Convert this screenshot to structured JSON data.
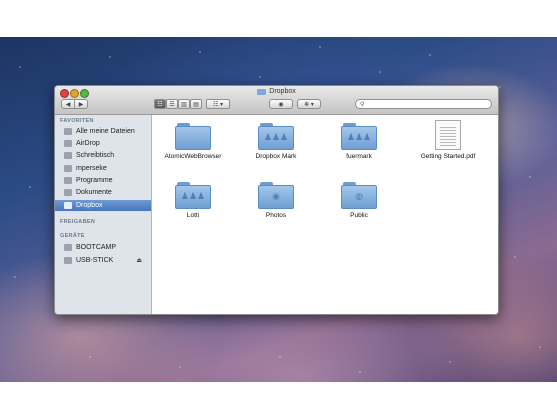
{
  "window": {
    "title": "Dropbox"
  },
  "toolbar": {
    "back_glyph": "◀",
    "forward_glyph": "▶",
    "view_icons": "☷",
    "view_list": "☰",
    "view_columns": "▥",
    "view_cover": "▤",
    "arrange": "☷ ▾",
    "quicklook": "◉",
    "action": "✻ ▾",
    "search_glyph": "⚲",
    "search_placeholder": ""
  },
  "sidebar": {
    "favorites_header": "FAVORITEN",
    "favorites": [
      {
        "label": "Alle meine Dateien",
        "icon": "all-files-icon"
      },
      {
        "label": "AirDrop",
        "icon": "airdrop-icon"
      },
      {
        "label": "Schreibtisch",
        "icon": "desktop-icon"
      },
      {
        "label": "mperseke",
        "icon": "home-icon"
      },
      {
        "label": "Programme",
        "icon": "applications-icon"
      },
      {
        "label": "Dokumente",
        "icon": "documents-icon"
      },
      {
        "label": "Dropbox",
        "icon": "dropbox-folder-icon",
        "selected": true
      }
    ],
    "shared_header": "FREIGABEN",
    "devices_header": "GERÄTE",
    "devices": [
      {
        "label": "BOOTCAMP",
        "icon": "drive-icon"
      },
      {
        "label": "USB-STICK",
        "icon": "drive-icon",
        "eject": "⏏"
      }
    ]
  },
  "files": [
    {
      "label": "AtomicWebBrowser",
      "icon": "folder-icon",
      "emblem": ""
    },
    {
      "label": "Dropbox Mark",
      "icon": "shared-folder-icon",
      "emblem": "♟♟♟"
    },
    {
      "label": "fuermark",
      "icon": "shared-folder-icon",
      "emblem": "♟♟♟"
    },
    {
      "label": "Getting Started.pdf",
      "icon": "pdf-document-icon",
      "emblem": ""
    },
    {
      "label": "Lotti",
      "icon": "shared-folder-icon",
      "emblem": "♟♟♟"
    },
    {
      "label": "Photos",
      "icon": "photos-folder-icon",
      "emblem": "◉"
    },
    {
      "label": "Public",
      "icon": "public-folder-icon",
      "emblem": "◍"
    }
  ],
  "colors": {
    "selection": "#4677bd",
    "folder": "#8fb7e2",
    "sidebar_bg": "#dfe4ea"
  }
}
